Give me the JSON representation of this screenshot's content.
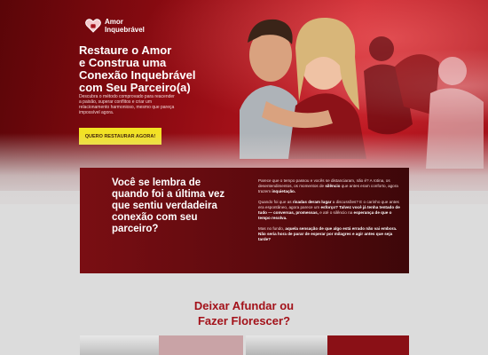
{
  "logo": {
    "line1": "Amor",
    "line2": "Inquebrável"
  },
  "hero": {
    "title_line1": "Restaure o Amor",
    "title_line2": "e Construa uma",
    "title_bold": "Conexão Inquebrável",
    "title_line4": "com Seu Parceiro(a)",
    "description": "Descubra o método comprovado para reacender a paixão, superar conflitos e criar um relacionamento harmonioso, mesmo que pareça impossível agora.",
    "cta_label": "QUERO RESTAURAR AGORA!"
  },
  "card": {
    "question": "Você se lembra de quando foi a última vez que sentiu verdadeira conexão com seu parceiro?",
    "p1_a": "Parece que o tempo passou e vocês se distanciaram, não é? A rotina, os desentendimentos, os momentos de ",
    "p1_b": "silêncio",
    "p1_c": " que antes eram conforto, agora trazem ",
    "p1_d": "inquietação.",
    "p2_a": "Quando foi que as ",
    "p2_b": "risadas deram lugar",
    "p2_c": " a discussões? E o carinho que antes era espontâneo, agora parece um ",
    "p2_d": "esforço? Talvez você já tenha tentado de tudo — conversas, promessas,",
    "p2_e": " e até o silêncio na ",
    "p2_f": "esperança de que o tempo resolva.",
    "p3_a": "Mas no fundo, ",
    "p3_b": "aquela sensação de que algo está errado não vai embora. Não seria hora de parar de esperar por milagres e agir antes que seja tarde?"
  },
  "section3": {
    "title_line1": "Deixar Afundar ou",
    "title_line2": "Fazer Florescer?"
  },
  "colors": {
    "accent": "#a3121a",
    "cta": "#f2e224",
    "card": "#5c0a0e"
  },
  "icons": {
    "logo": "heart-lock-icon"
  }
}
